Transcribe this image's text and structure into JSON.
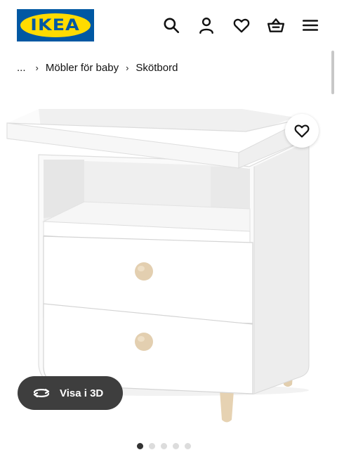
{
  "header": {
    "logo_text": "IKEA",
    "icons": [
      "search-icon",
      "account-icon",
      "heart-icon",
      "cart-icon",
      "menu-icon"
    ]
  },
  "breadcrumb": {
    "ellipsis": "...",
    "items": [
      "Möbler för baby",
      "Skötbord"
    ]
  },
  "product": {
    "favorite_icon": "heart-icon",
    "view_3d_label": "Visa i 3D"
  },
  "carousel": {
    "total": 5,
    "active": 1
  },
  "colors": {
    "brand_blue": "#0058a3",
    "brand_yellow": "#ffdb00",
    "pill_bg": "#3e3e3e",
    "knob": "#e3cfb0"
  }
}
